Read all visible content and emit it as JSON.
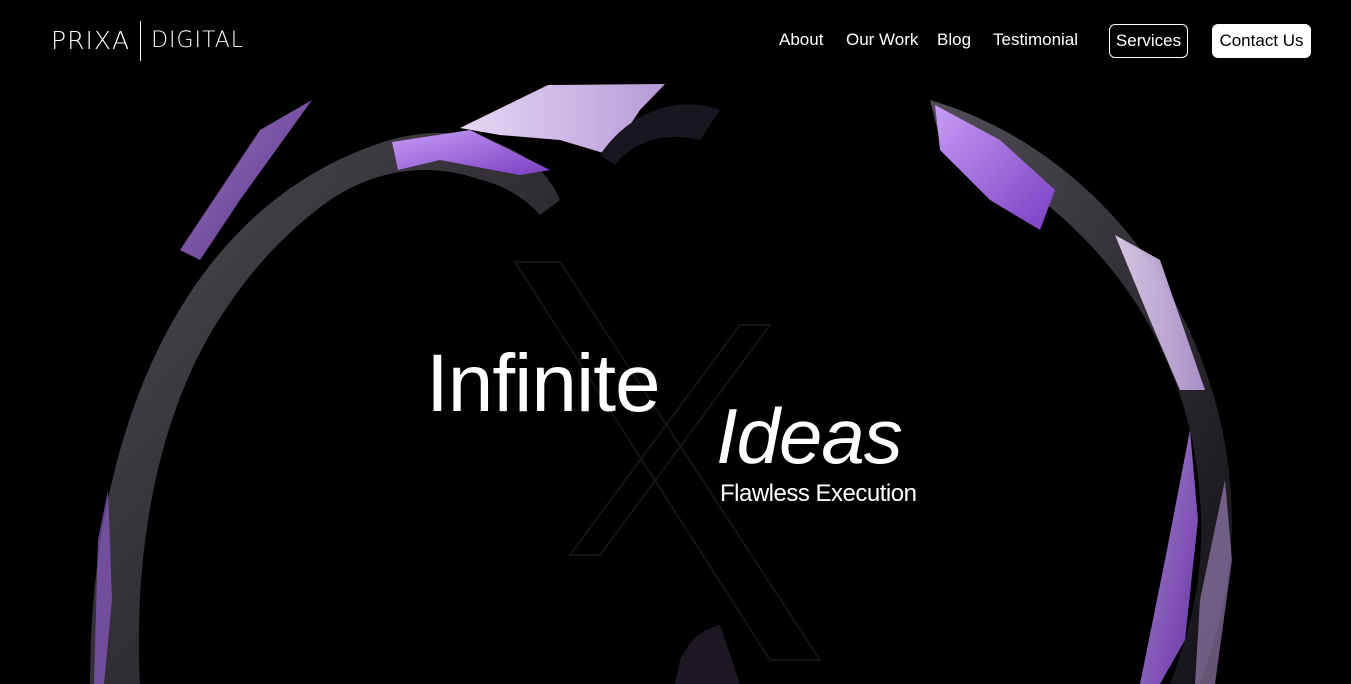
{
  "header": {
    "logo": {
      "left": "PRIXA",
      "right": "DIGITAL"
    },
    "nav": {
      "links": [
        "About",
        "Our Work",
        "Blog",
        "Testimonial"
      ],
      "services_label": "Services",
      "contact_label": "Contact Us"
    }
  },
  "hero": {
    "title_line1": "Infinite",
    "title_line2": "Ideas",
    "subtitle": "Flawless Execution"
  },
  "colors": {
    "background": "#000000",
    "text": "#ffffff",
    "accent_purple": "#a878e0",
    "accent_lavender": "#d9c8ef"
  }
}
